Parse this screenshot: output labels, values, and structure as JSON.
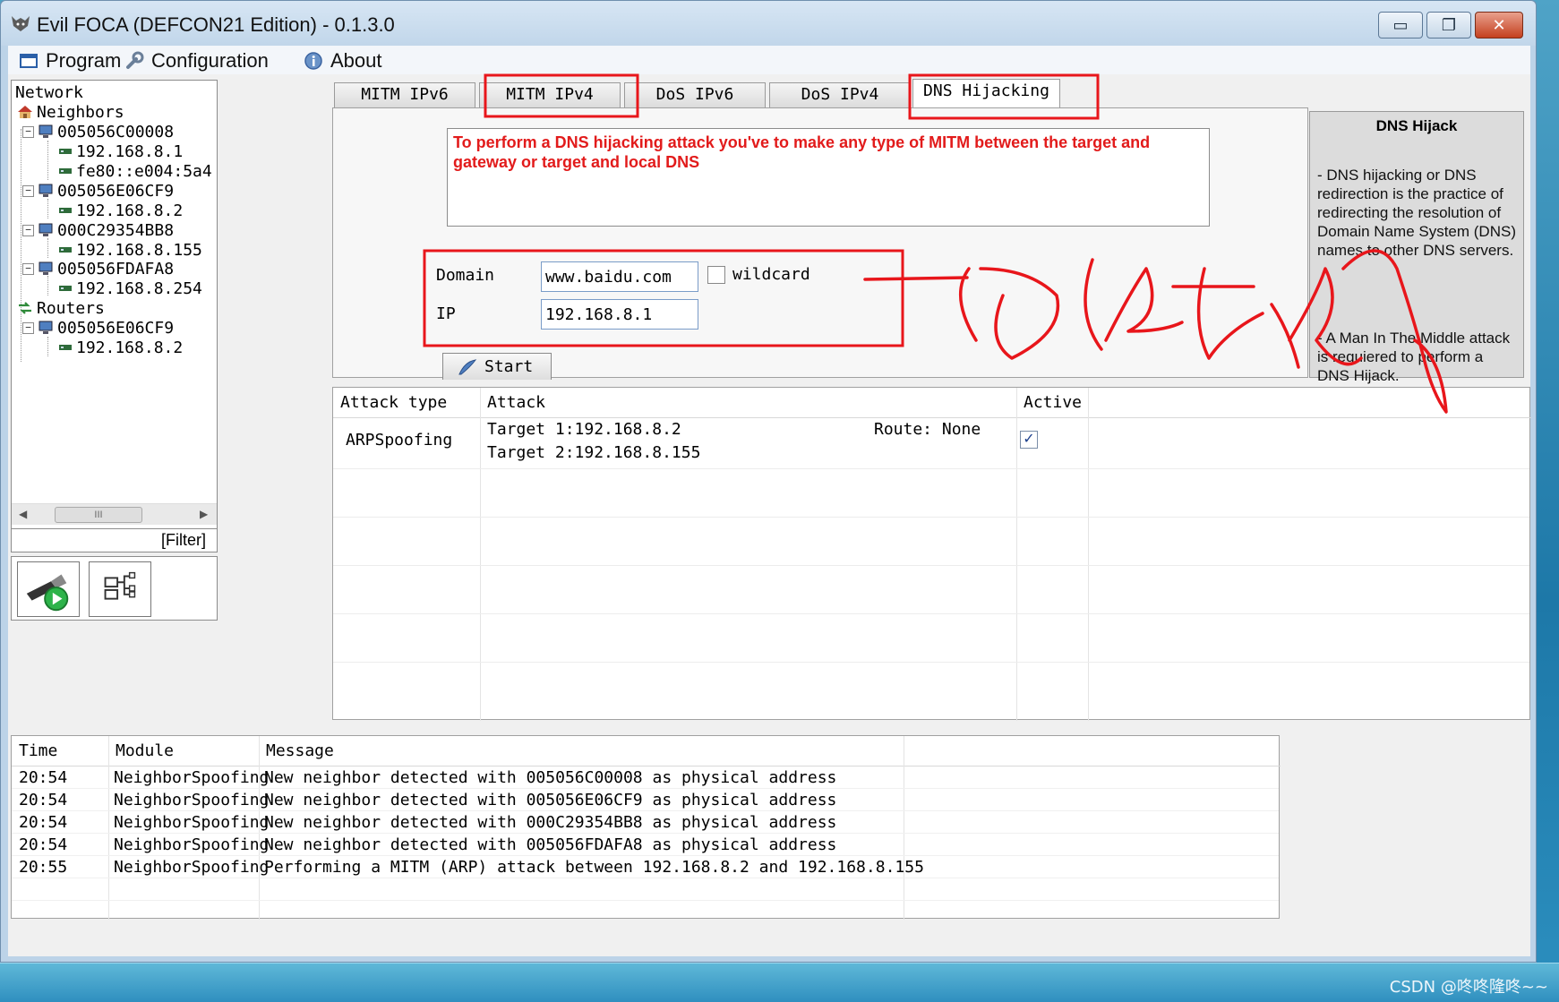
{
  "window": {
    "title": "Evil FOCA (DEFCON21 Edition) - 0.1.3.0",
    "minimize": "▭",
    "maximize": "❐",
    "close": "✕"
  },
  "menu": {
    "program": "Program",
    "configuration": "Configuration",
    "about": "About"
  },
  "tree": {
    "root": "Network",
    "neighbors_label": "Neighbors",
    "neighbors": [
      {
        "mac": "005056C00008",
        "ips": [
          "192.168.8.1",
          "fe80::e004:5a4"
        ]
      },
      {
        "mac": "005056E06CF9",
        "ips": [
          "192.168.8.2"
        ]
      },
      {
        "mac": "000C29354BB8",
        "ips": [
          "192.168.8.155"
        ]
      },
      {
        "mac": "005056FDAFA8",
        "ips": [
          "192.168.8.254"
        ]
      }
    ],
    "routers_label": "Routers",
    "routers": [
      {
        "mac": "005056E06CF9",
        "ips": [
          "192.168.8.2"
        ]
      }
    ],
    "scroll_thumb": "III",
    "filter": "[Filter]"
  },
  "tabs": [
    {
      "label": "MITM IPv6"
    },
    {
      "label": "MITM IPv4"
    },
    {
      "label": "DoS IPv6"
    },
    {
      "label": "DoS IPv4"
    },
    {
      "label": "DNS Hijacking"
    }
  ],
  "dns": {
    "info": "To perform a DNS hijacking attack you've to make any type of MITM between the target and gateway or target and local DNS",
    "domain_label": "Domain",
    "domain_value": "www.baidu.com",
    "wildcard_label": "wildcard",
    "ip_label": "IP",
    "ip_value": "192.168.8.1",
    "start_label": "Start"
  },
  "help": {
    "title": "DNS Hijack",
    "text1": "- DNS hijacking or DNS redirection is the practice of redirecting the resolution of Domain Name System (DNS) names to other DNS servers.",
    "text2": "- A Man In The Middle attack is requiered to perform a DNS Hijack."
  },
  "attacks": {
    "headers": [
      "Attack type",
      "Attack",
      "Active"
    ],
    "rows": [
      {
        "type": "ARPSpoofing",
        "target1": "Target 1:192.168.8.2",
        "target2": "Target 2:192.168.8.155",
        "route": "Route: None",
        "active_mark": "✓"
      }
    ]
  },
  "log": {
    "headers": [
      "Time",
      "Module",
      "Message"
    ],
    "rows": [
      {
        "time": "20:54",
        "module": "NeighborSpoofing",
        "message": "New neighbor detected with 005056C00008 as physical address"
      },
      {
        "time": "20:54",
        "module": "NeighborSpoofing",
        "message": "New neighbor detected with 005056E06CF9 as physical address"
      },
      {
        "time": "20:54",
        "module": "NeighborSpoofing",
        "message": "New neighbor detected with 000C29354BB8 as physical address"
      },
      {
        "time": "20:54",
        "module": "NeighborSpoofing",
        "message": "New neighbor detected with 005056FDAFA8 as physical address"
      },
      {
        "time": "20:55",
        "module": "NeighborSpoofing",
        "message": "Performing a MITM (ARP) attack between 192.168.8.2 and 192.168.8.155"
      }
    ]
  },
  "watermark": "CSDN @咚咚隆咚~~",
  "colors": {
    "annotation": "#e8161b",
    "info_text": "#e21b1b"
  }
}
